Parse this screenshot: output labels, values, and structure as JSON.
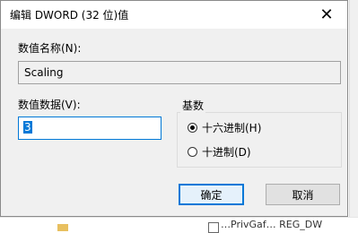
{
  "dialog": {
    "title": "编辑 DWORD (32 位)值",
    "close_glyph": "✕",
    "value_name_label": "数值名称(N):",
    "value_name": "Scaling",
    "value_data_label": "数值数据(V):",
    "value_data": "3",
    "base_group_label": "基数",
    "radix_options": [
      {
        "label": "十六进制(H)",
        "selected": true
      },
      {
        "label": "十进制(D)",
        "selected": false
      }
    ],
    "ok_label": "确定",
    "cancel_label": "取消"
  },
  "background": {
    "partial_text": "…PrivGaf… REG_DW"
  },
  "colors": {
    "accent": "#0078d7",
    "dialog_bg": "#f0f0f0",
    "titlebar_bg": "#ffffff"
  }
}
